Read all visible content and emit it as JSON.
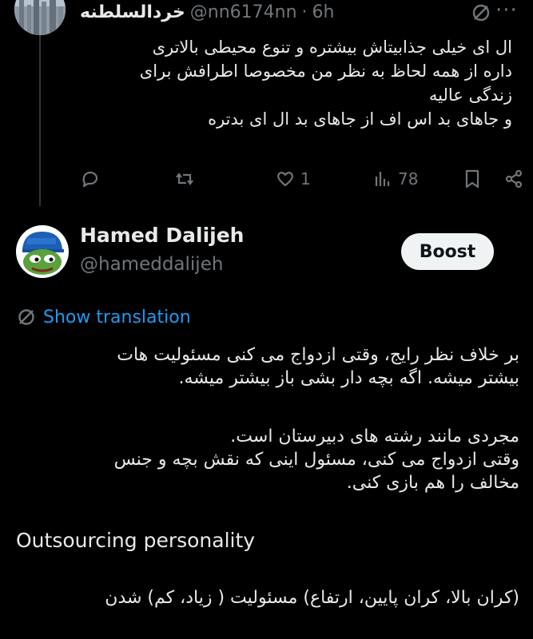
{
  "reply": {
    "name": "خردالسلطنه",
    "handle": "@nn6174nn",
    "separator": "·",
    "time": "6h",
    "text_lines": [
      "ال ای خیلی جذابیتاش بیشتره و تنوع محیطی بالاتری",
      "داره از همه لحاظ به نظر من مخصوصا اطرافش برای",
      "زندگی عالیه",
      "و جاهای بد اس اف از جاهای بد ال ای بدتره"
    ],
    "actions": {
      "reply_count": "",
      "repost_count": "",
      "like_count": "1",
      "views_count": "78"
    }
  },
  "main": {
    "author_name": "Hamed Dalijeh",
    "author_handle": "@hameddalijeh",
    "boost_label": "Boost",
    "show_translation": "Show translation",
    "text_lines": [
      "بر خلاف نظر رایج، وقتی ازدواج می کنی مسئولیت هات",
      "بیشتر میشه. اگه بچه دار بشی باز بیشتر میشه.",
      "",
      "مجردی مانند رشته های دبیرستان است.",
      "وقتی ازدواج می کنی، مسئول اینی که نقش بچه و جنس",
      "مخالف را هم بازی کنی."
    ],
    "latin_line": "Outsourcing personality",
    "last_line": "(کران بالا، کران پایین، ارتفاع) مسئولیت ( زیاد، کم) شدن"
  },
  "colors": {
    "background": "#000000",
    "text": "#e7e9ea",
    "muted": "#71767b",
    "link": "#1d9bf0",
    "boost_bg": "#eff3f4"
  }
}
